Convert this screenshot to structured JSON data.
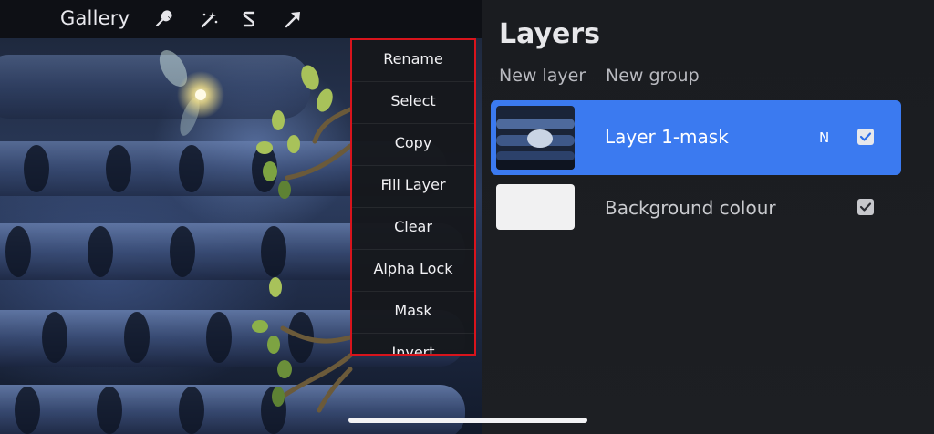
{
  "toolbar": {
    "gallery_label": "Gallery",
    "icons": [
      "wrench-icon",
      "magic-wand-icon",
      "selection-icon",
      "transform-arrow-icon"
    ]
  },
  "context_menu": {
    "items": [
      "Rename",
      "Select",
      "Copy",
      "Fill Layer",
      "Clear",
      "Alpha Lock",
      "Mask",
      "Invert"
    ]
  },
  "layers_panel": {
    "title": "Layers",
    "new_layer_label": "New layer",
    "new_group_label": "New group",
    "layers": [
      {
        "name": "Layer 1-mask",
        "blend_mode": "N",
        "visible": true,
        "selected": true
      },
      {
        "name": "Background colour",
        "visible": true,
        "selected": false
      }
    ]
  },
  "colors": {
    "accent": "#3b7af0",
    "menu_highlight_border": "#d8141c",
    "panel_bg": "#1b1d21"
  }
}
